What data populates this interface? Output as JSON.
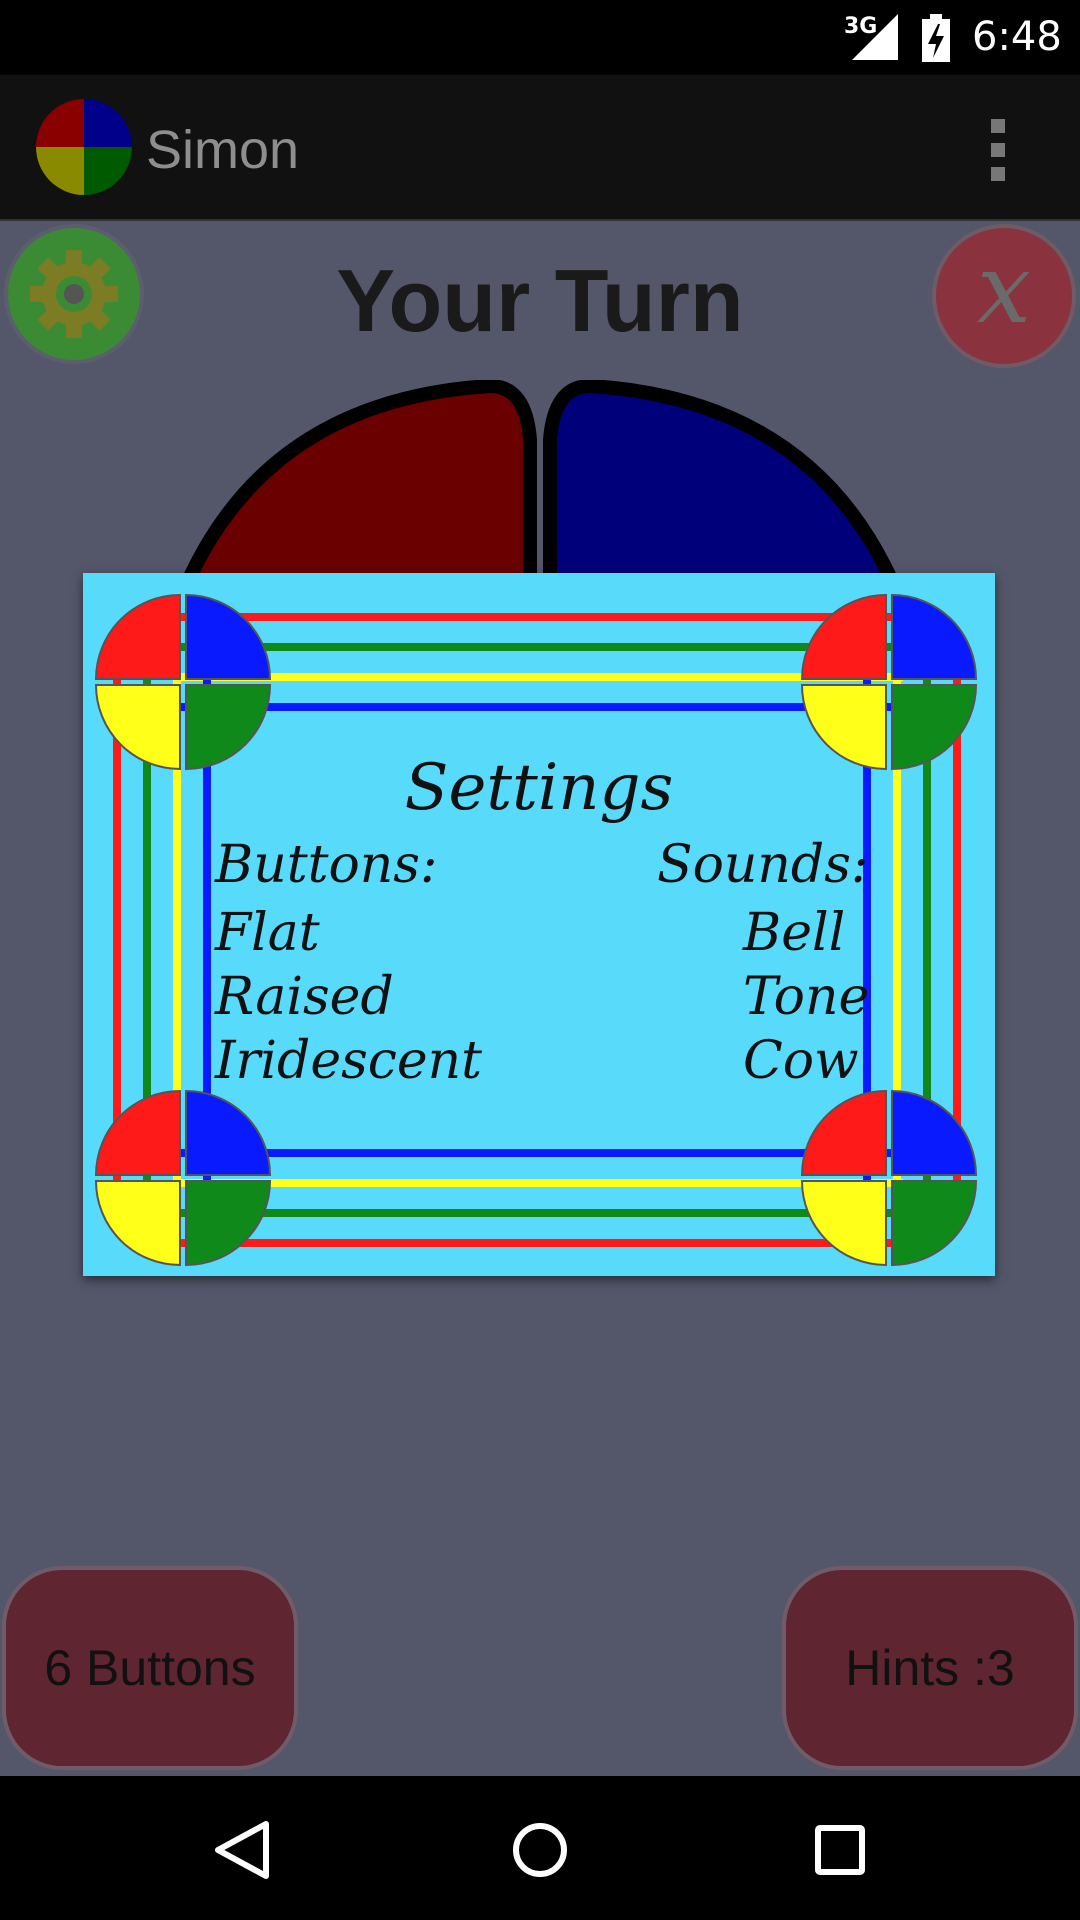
{
  "status_bar": {
    "network": "3G",
    "time": "6:48"
  },
  "app_bar": {
    "title": "Simon",
    "menu_icon": "overflow-menu-icon"
  },
  "game": {
    "turn_text": "Your Turn",
    "settings_icon": "gear-icon",
    "exit_label": "x",
    "board_colors": [
      "#6a0000",
      "#00007a"
    ]
  },
  "dialog": {
    "title": "Settings",
    "buttons_header": "Buttons:",
    "sounds_header": "Sounds:",
    "button_options": [
      "Flat",
      "Raised",
      "Iridescent"
    ],
    "sound_options": [
      "Bell",
      "Tone",
      "Cow"
    ]
  },
  "bottom": {
    "left_label": "6 Buttons",
    "right_label": "Hints :3"
  },
  "nav": {
    "back_icon": "back-icon",
    "home_icon": "home-icon",
    "recent_icon": "recent-apps-icon"
  },
  "colors": {
    "red": "#ff1a1a",
    "blue": "#0a1aff",
    "yellow": "#ffff1a",
    "green": "#0f8a1a",
    "dialog_bg": "#58dbfb"
  }
}
